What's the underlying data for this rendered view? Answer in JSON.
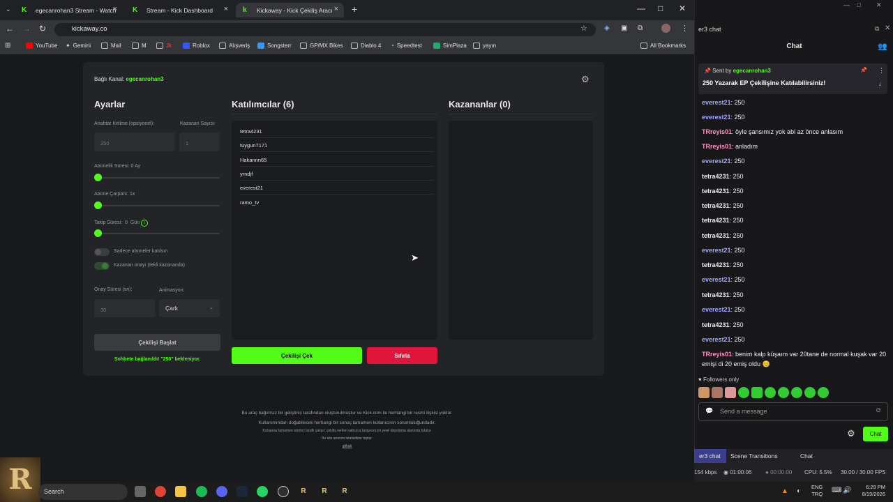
{
  "browser": {
    "tabs": [
      {
        "label": "egecanrohan3 Stream - Watch"
      },
      {
        "label": "Stream - Kick Dashboard"
      },
      {
        "label": "Kickaway - Kick Çekiliş Aracı"
      }
    ],
    "url": "kickaway.co",
    "bookmarks": [
      "YouTube",
      "Gemini",
      "Mail",
      "M",
      "",
      "Roblox",
      "Alışveriş",
      "Songsterr",
      "GP/MX Bikes",
      "Diablo 4",
      "Speedtest",
      "SimPlaza",
      "yayın"
    ],
    "all_bookmarks": "All Bookmarks"
  },
  "app": {
    "channel_label": "Bağlı Kanal:",
    "channel_name": "egecanrohan3",
    "settings": {
      "title": "Ayarlar",
      "keyword_label": "Anahtar Kelime (opsiyonel):",
      "keyword_value": "250",
      "winners_label": "Kazanan Sayısı:",
      "winners_value": "1",
      "sub_duration_label": "Abonelik Süresi: 0 Ay",
      "sub_multiplier_label": "Abone Çarpanı: 1x",
      "follow_label": "Takip Süresi:",
      "follow_value": "0",
      "follow_unit": "Gün",
      "only_subs_label": "Sadece aboneler katılsın",
      "winner_confirm_label": "Kazanan onayı (tekli kazananda)",
      "confirm_time_label": "Onay Süresi (sn):",
      "confirm_time_value": "30",
      "animation_label": "Animasyon:",
      "animation_value": "Çark",
      "start_button": "Çekilişi Başlat",
      "status": "Sohbete bağlanıldı! \"250\" bekleniyor."
    },
    "participants": {
      "title": "Katılımcılar (6)",
      "items": [
        "tetra4231",
        "tuygun7171",
        "Hakannn65",
        "yrndjf",
        "everest21",
        "ramo_tv"
      ]
    },
    "winners": {
      "title": "Kazananlar (0)"
    },
    "draw_button": "Çekilişi Çek",
    "reset_button": "Sıfırla",
    "footer": [
      "Bu araç bağımsız bir geliştirici tarafından oluşturulmuştur ve Kick.com ile herhangi bir resmi ilişkisi yoktur.",
      "Kullanımından doğabilecek herhangi bir sonuç tamamen kullanıcının sorumluluğundadır.",
      "Kickaway tamamen istemci taraflı çalışır; çekiliş verileri yalnızca tarayıcınızın yerel depolama alanında tutulur.",
      "Bu site anonim istatistikler toplar.",
      "github"
    ]
  },
  "chat": {
    "window_title": "er3 chat",
    "header": "Chat",
    "pinned": {
      "sent_by": "Sent by",
      "user": "egecanrohan3",
      "text": "250 Yazarak EP Çekilişine Katılabilirsiniz!"
    },
    "messages": [
      {
        "user": "everest21",
        "text": ": 250",
        "c": "blue"
      },
      {
        "user": "everest21",
        "text": ": 250",
        "c": "blue"
      },
      {
        "user": "TRreyis01",
        "text": ": öyle şansımız yok abi az önce anlasım",
        "c": "pink"
      },
      {
        "user": "TRreyis01",
        "text": ": anladım",
        "c": "pink"
      },
      {
        "user": "everest21",
        "text": ": 250",
        "c": "blue"
      },
      {
        "user": "tetra4231",
        "text": ": 250",
        "c": "white"
      },
      {
        "user": "tetra4231",
        "text": ": 250",
        "c": "white"
      },
      {
        "user": "tetra4231",
        "text": ": 250",
        "c": "white"
      },
      {
        "user": "tetra4231",
        "text": ": 250",
        "c": "white"
      },
      {
        "user": "tetra4231",
        "text": ": 250",
        "c": "white"
      },
      {
        "user": "everest21",
        "text": ": 250",
        "c": "blue"
      },
      {
        "user": "tetra4231",
        "text": ": 250",
        "c": "white"
      },
      {
        "user": "everest21",
        "text": ": 250",
        "c": "blue"
      },
      {
        "user": "tetra4231",
        "text": ": 250",
        "c": "white"
      },
      {
        "user": "everest21",
        "text": ": 250",
        "c": "blue"
      },
      {
        "user": "tetra4231",
        "text": ": 250",
        "c": "white"
      },
      {
        "user": "everest21",
        "text": ": 250",
        "c": "blue"
      },
      {
        "user": "TRreyis01",
        "text": ": benim kalp küşaım var 20tane de normal kuşak var 20 emişi di 20 emiş oldu 😊",
        "c": "pink"
      }
    ],
    "followers_only": "Followers only",
    "input_placeholder": "Send a message",
    "chat_button": "Chat"
  },
  "obs": {
    "tabs": [
      "er3 chat",
      "Scene Transitions",
      "Chat"
    ],
    "kbps": "154 kbps",
    "rec_time": "01:00:06",
    "stream_time": "00:00:00",
    "cpu": "CPU: 5.5%",
    "fps": "30.00 / 30.00 FPS"
  },
  "taskbar": {
    "search": "Search",
    "lang1": "ENG",
    "lang2": "TRQ",
    "time": "6:29 PM",
    "date": "8/19/2026"
  }
}
